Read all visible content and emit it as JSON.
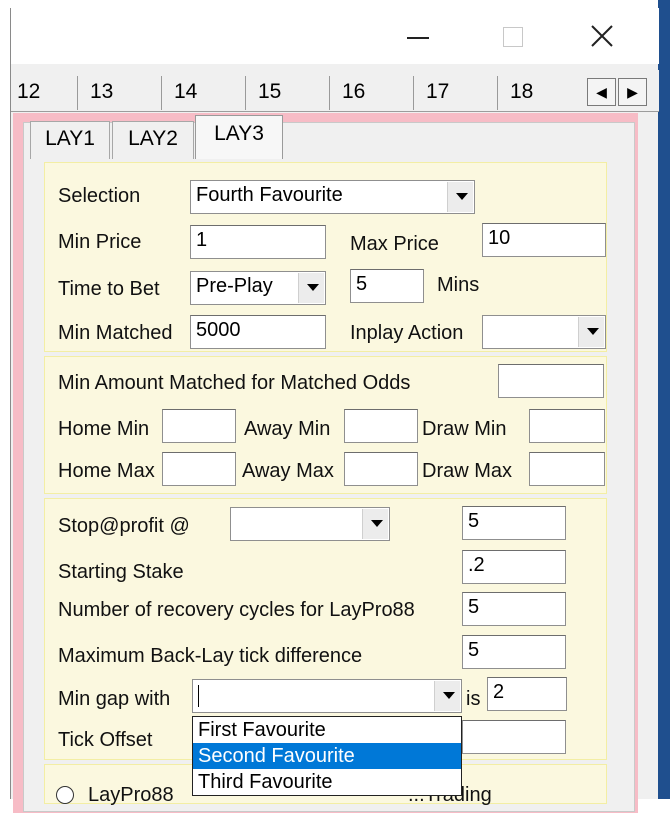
{
  "numbered_tabs": [
    "12",
    "13",
    "14",
    "15",
    "16",
    "17",
    "18"
  ],
  "scroll_buttons": {
    "left": "◀",
    "right": "▶"
  },
  "lay_tabs": [
    "LAY1",
    "LAY2",
    "LAY3"
  ],
  "active_lay_tab": "LAY3",
  "settings": {
    "selection_label": "Selection",
    "selection_value": "Fourth Favourite",
    "min_price_label": "Min Price",
    "min_price_value": "1",
    "max_price_label": "Max Price",
    "max_price_value": "10",
    "time_to_bet_label": "Time to Bet",
    "time_to_bet_value": "Pre-Play",
    "mins_value": "5",
    "mins_label": "Mins",
    "min_matched_label": "Min Matched",
    "min_matched_value": "5000",
    "inplay_action_label": "Inplay Action",
    "inplay_action_value": ""
  },
  "matched_odds": {
    "heading": "Min Amount Matched for Matched Odds",
    "home_min_label": "Home Min",
    "away_min_label": "Away Min",
    "draw_min_label": "Draw Min",
    "home_max_label": "Home Max",
    "away_max_label": "Away Max",
    "draw_max_label": "Draw Max"
  },
  "staking": {
    "stop_profit_label": "Stop@profit @",
    "stop_profit_combo_value": "",
    "stop_profit_value": "5",
    "starting_stake_label": "Starting Stake",
    "starting_stake_value": ".2",
    "recovery_label": "Number of recovery cycles for LayPro88",
    "recovery_value": "5",
    "tick_diff_label": "Maximum Back-Lay tick difference",
    "tick_diff_value": "5",
    "min_gap_label": "Min gap with",
    "min_gap_combo_value": "",
    "is_label": "is",
    "is_value": "2",
    "tick_offset_label": "Tick Offset",
    "tick_offset_value": ""
  },
  "dropdown_options": [
    "First Favourite",
    "Second Favourite",
    "Third Favourite"
  ],
  "dropdown_selected_index": 1,
  "bottom": {
    "radio_label_1": "LayPro88",
    "radio_label_2": "...Trading"
  },
  "colors": {
    "panel_border_pink": "#f7bcc6",
    "group_yellow": "#fbf8df",
    "selection_blue": "#0078d7",
    "desktop_blue": "#1f4f8e"
  }
}
